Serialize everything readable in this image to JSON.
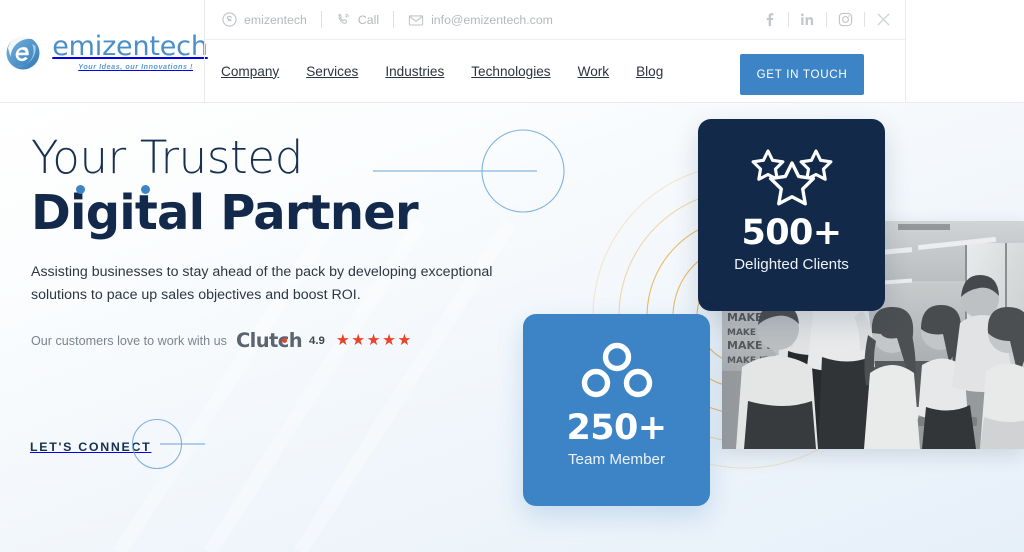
{
  "brand": {
    "name": "emizentech",
    "tagline": "Your Ideas, our Innovations !",
    "logo_color": "#4a8fc7"
  },
  "topbar": {
    "contacts": [
      {
        "icon": "skype-icon",
        "label": "emizentech"
      },
      {
        "icon": "phone-call-icon",
        "label": "Call"
      },
      {
        "icon": "envelope-icon",
        "label": "info@emizentech.com"
      }
    ],
    "socials": [
      {
        "icon": "facebook-icon",
        "label": "f"
      },
      {
        "icon": "linkedin-icon",
        "label": "in"
      },
      {
        "icon": "instagram-icon",
        "label": "Instagram"
      },
      {
        "icon": "x-twitter-icon",
        "label": "X"
      }
    ]
  },
  "nav": {
    "items": [
      {
        "label": "Company"
      },
      {
        "label": "Services"
      },
      {
        "label": "Industries"
      },
      {
        "label": "Technologies"
      },
      {
        "label": "Work"
      },
      {
        "label": "Blog"
      }
    ],
    "cta_label": "GET IN TOUCH",
    "cta_color": "#3c84c6"
  },
  "hero": {
    "heading_line1": "Your Trusted",
    "heading_line2": "Digital Partner",
    "paragraph": "Assisting businesses to stay ahead of the pack by developing exceptional solutions to pace up sales objectives and boost ROI.",
    "review": {
      "lead": "Our customers love to work with us",
      "platform": "Clutch",
      "score": "4.9",
      "stars": 5,
      "star_color": "#e8442a"
    },
    "connect_label": "LET'S CONNECT"
  },
  "stats": [
    {
      "icon": "three-stars-icon",
      "number": "500+",
      "label": "Delighted Clients",
      "bg": "#12294a"
    },
    {
      "icon": "three-circles-team-icon",
      "number": "250+",
      "label": "Team Member",
      "bg": "#3c84c6"
    }
  ],
  "photo": {
    "alt": "Team of colleagues collaborating around a laptop in an office"
  }
}
